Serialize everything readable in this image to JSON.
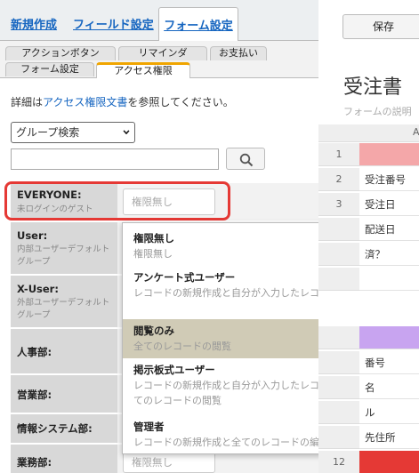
{
  "top_tabs": {
    "new": "新規作成",
    "field": "フィールド設定",
    "form": "フォーム設定"
  },
  "sub_tabs": {
    "action": "アクションボタン",
    "remind": "リマインダ",
    "pay": "お支払い",
    "formset": "フォーム設定",
    "access": "アクセス権限"
  },
  "help": {
    "prefix": "詳細は",
    "link": "アクセス権限文書",
    "suffix": "を参照してください。"
  },
  "group_select": {
    "value": "グループ検索"
  },
  "search": {
    "value": "",
    "placeholder": ""
  },
  "roles": [
    {
      "label": "EVERYONE:",
      "desc": "未ログインのゲスト",
      "perm": "権限無し"
    },
    {
      "label": "User:",
      "desc": "内部ユーザーデフォルトグループ",
      "perm": ""
    },
    {
      "label": "X-User:",
      "desc": "外部ユーザーデフォルトグループ",
      "perm": ""
    },
    {
      "label": "人事部:",
      "desc": "",
      "perm": ""
    },
    {
      "label": "営業部:",
      "desc": "",
      "perm": ""
    },
    {
      "label": "情報システム部:",
      "desc": "",
      "perm": ""
    },
    {
      "label": "業務部:",
      "desc": "",
      "perm": "権限無し"
    }
  ],
  "dropdown": [
    {
      "title": "権限無し",
      "desc": "権限無し",
      "selected": false
    },
    {
      "title": "アンケート式ユーザー",
      "desc": "レコードの新規作成と自分が入力したレコードの編集",
      "selected": false
    },
    {
      "title": "閲覧のみ",
      "desc": "全てのレコードの閲覧",
      "selected": true
    },
    {
      "title": "掲示板式ユーザー",
      "desc": "レコードの新規作成と自分が入力したレコードの編集＋全てのレコードの閲覧",
      "selected": false
    },
    {
      "title": "管理者",
      "desc": "レコードの新規作成と全てのレコードの編集",
      "selected": false
    }
  ],
  "right": {
    "save": "保存",
    "title": "受注書",
    "desc": "フォームの説明",
    "col_a": "A",
    "rows": [
      {
        "num": "1",
        "cell": "",
        "color": "#f4a7a9"
      },
      {
        "num": "2",
        "cell": "受注番号"
      },
      {
        "num": "3",
        "cell": "受注日"
      },
      {
        "num": "",
        "cell": "配送日"
      },
      {
        "num": "",
        "cell": "済？"
      },
      {
        "num": "",
        "cell": ""
      },
      {
        "num": "",
        "cell": "",
        "color": "#c8a4f0"
      },
      {
        "num": "",
        "cell": "番号"
      },
      {
        "num": "",
        "cell": "名"
      },
      {
        "num": "",
        "cell": "ル"
      },
      {
        "num": "",
        "cell": "先住所"
      },
      {
        "num": "12",
        "cell": "",
        "color": "#e53935"
      }
    ]
  },
  "colors": {
    "link": "#1565c0",
    "highlight": "#e53935",
    "active_tab_accent": "#f0a500",
    "selected_option": "#d0cbb6"
  }
}
